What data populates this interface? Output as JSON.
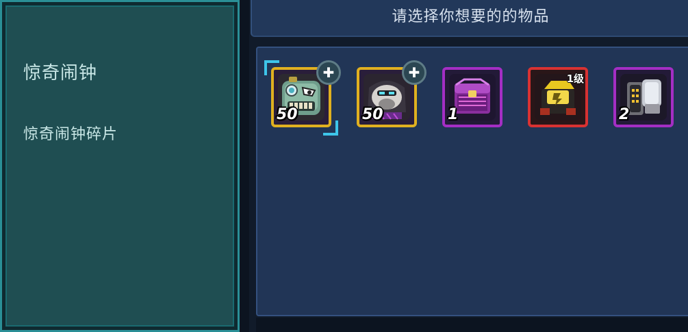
{
  "detail": {
    "title": "惊奇闹钟",
    "subtitle": "惊奇闹钟碎片"
  },
  "header": {
    "title": "请选择你想要的的物品"
  },
  "items": [
    {
      "name": "惊奇闹钟碎片",
      "quantity": "50",
      "rarity": "gold",
      "icon": "alarm-clock-robot-icon",
      "badge": "puzzle-piece-icon",
      "selected": true
    },
    {
      "name": "",
      "quantity": "50",
      "rarity": "gold",
      "icon": "gorilla-robot-icon",
      "badge": "puzzle-piece-icon",
      "selected": false
    },
    {
      "name": "",
      "quantity": "1",
      "rarity": "purple",
      "icon": "purple-crate-icon",
      "badge": "",
      "selected": false
    },
    {
      "name": "",
      "quantity": "",
      "level": "1级",
      "rarity": "red",
      "icon": "gold-chest-icon",
      "badge": "",
      "selected": false
    },
    {
      "name": "",
      "quantity": "2",
      "rarity": "purple",
      "icon": "battery-module-icon",
      "badge": "",
      "selected": false
    }
  ],
  "colors": {
    "gold_frame": "#e0b020",
    "purple_frame": "#a42ec4",
    "red_frame": "#d83232",
    "selection": "#3ec5ea",
    "detail_panel": "#1f4e52",
    "items_panel": "#213556"
  }
}
